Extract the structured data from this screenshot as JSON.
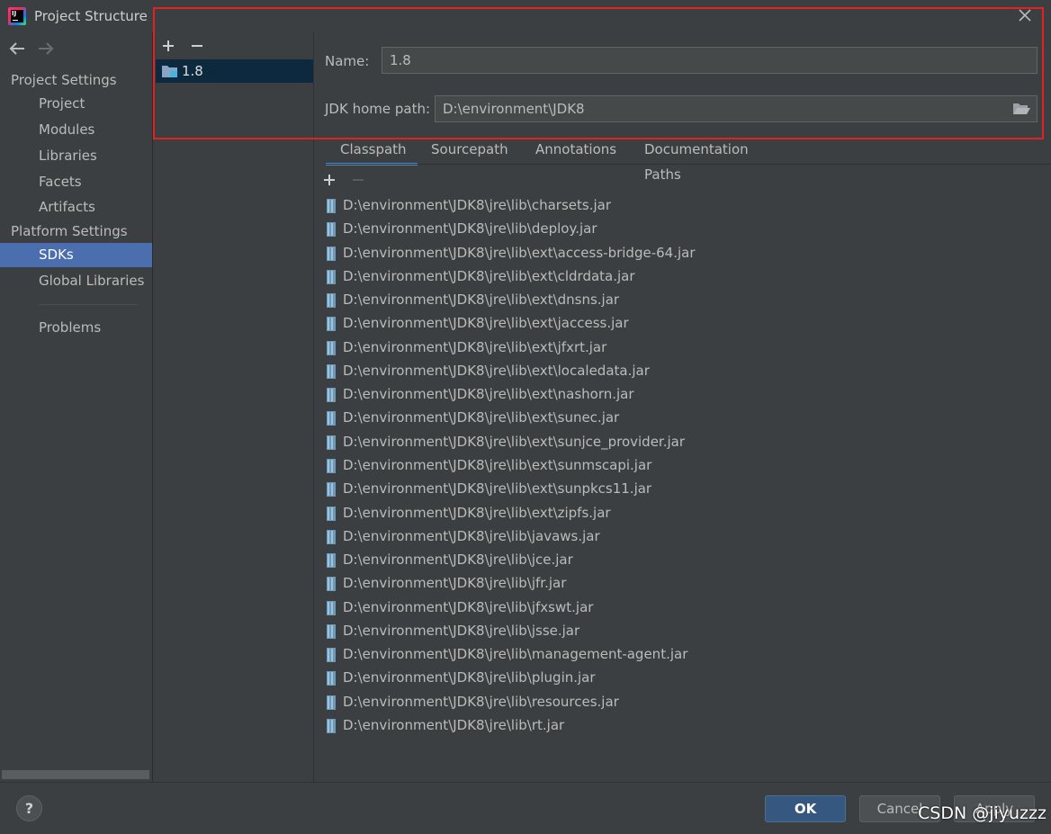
{
  "window": {
    "title": "Project Structure",
    "app_icon_text": "IJ",
    "close_icon": "close-icon"
  },
  "nav": {
    "back_icon": "arrow-left-icon",
    "forward_icon": "arrow-right-icon",
    "section_project": "Project Settings",
    "section_platform": "Platform Settings",
    "items": {
      "project": "Project",
      "modules": "Modules",
      "libraries": "Libraries",
      "facets": "Facets",
      "artifacts": "Artifacts",
      "sdks": "SDKs",
      "global_libraries": "Global Libraries",
      "problems": "Problems"
    },
    "selected": "SDKs"
  },
  "sdk_list": {
    "add_icon": "plus-icon",
    "remove_icon": "minus-icon",
    "items": [
      "1.8"
    ]
  },
  "sdk_detail": {
    "name_label": "Name:",
    "name_value": "1.8",
    "home_label": "JDK home path:",
    "home_value": "D:\\environment\\JDK8",
    "browse_icon": "folder-open-icon"
  },
  "tabs": [
    "Classpath",
    "Sourcepath",
    "Annotations",
    "Documentation Paths"
  ],
  "active_tab": "Classpath",
  "classpath": [
    "D:\\environment\\JDK8\\jre\\lib\\charsets.jar",
    "D:\\environment\\JDK8\\jre\\lib\\deploy.jar",
    "D:\\environment\\JDK8\\jre\\lib\\ext\\access-bridge-64.jar",
    "D:\\environment\\JDK8\\jre\\lib\\ext\\cldrdata.jar",
    "D:\\environment\\JDK8\\jre\\lib\\ext\\dnsns.jar",
    "D:\\environment\\JDK8\\jre\\lib\\ext\\jaccess.jar",
    "D:\\environment\\JDK8\\jre\\lib\\ext\\jfxrt.jar",
    "D:\\environment\\JDK8\\jre\\lib\\ext\\localedata.jar",
    "D:\\environment\\JDK8\\jre\\lib\\ext\\nashorn.jar",
    "D:\\environment\\JDK8\\jre\\lib\\ext\\sunec.jar",
    "D:\\environment\\JDK8\\jre\\lib\\ext\\sunjce_provider.jar",
    "D:\\environment\\JDK8\\jre\\lib\\ext\\sunmscapi.jar",
    "D:\\environment\\JDK8\\jre\\lib\\ext\\sunpkcs11.jar",
    "D:\\environment\\JDK8\\jre\\lib\\ext\\zipfs.jar",
    "D:\\environment\\JDK8\\jre\\lib\\javaws.jar",
    "D:\\environment\\JDK8\\jre\\lib\\jce.jar",
    "D:\\environment\\JDK8\\jre\\lib\\jfr.jar",
    "D:\\environment\\JDK8\\jre\\lib\\jfxswt.jar",
    "D:\\environment\\JDK8\\jre\\lib\\jsse.jar",
    "D:\\environment\\JDK8\\jre\\lib\\management-agent.jar",
    "D:\\environment\\JDK8\\jre\\lib\\plugin.jar",
    "D:\\environment\\JDK8\\jre\\lib\\resources.jar",
    "D:\\environment\\JDK8\\jre\\lib\\rt.jar"
  ],
  "footer": {
    "help_label": "?",
    "ok_label": "OK",
    "cancel_label": "Cancel",
    "apply_label": "Apply",
    "watermark": "CSDN @jiyuzzz"
  },
  "colors": {
    "background": "#3c3f41",
    "selection": "#4b6eaf",
    "highlight_border": "#e02222",
    "primary_button": "#365880"
  }
}
